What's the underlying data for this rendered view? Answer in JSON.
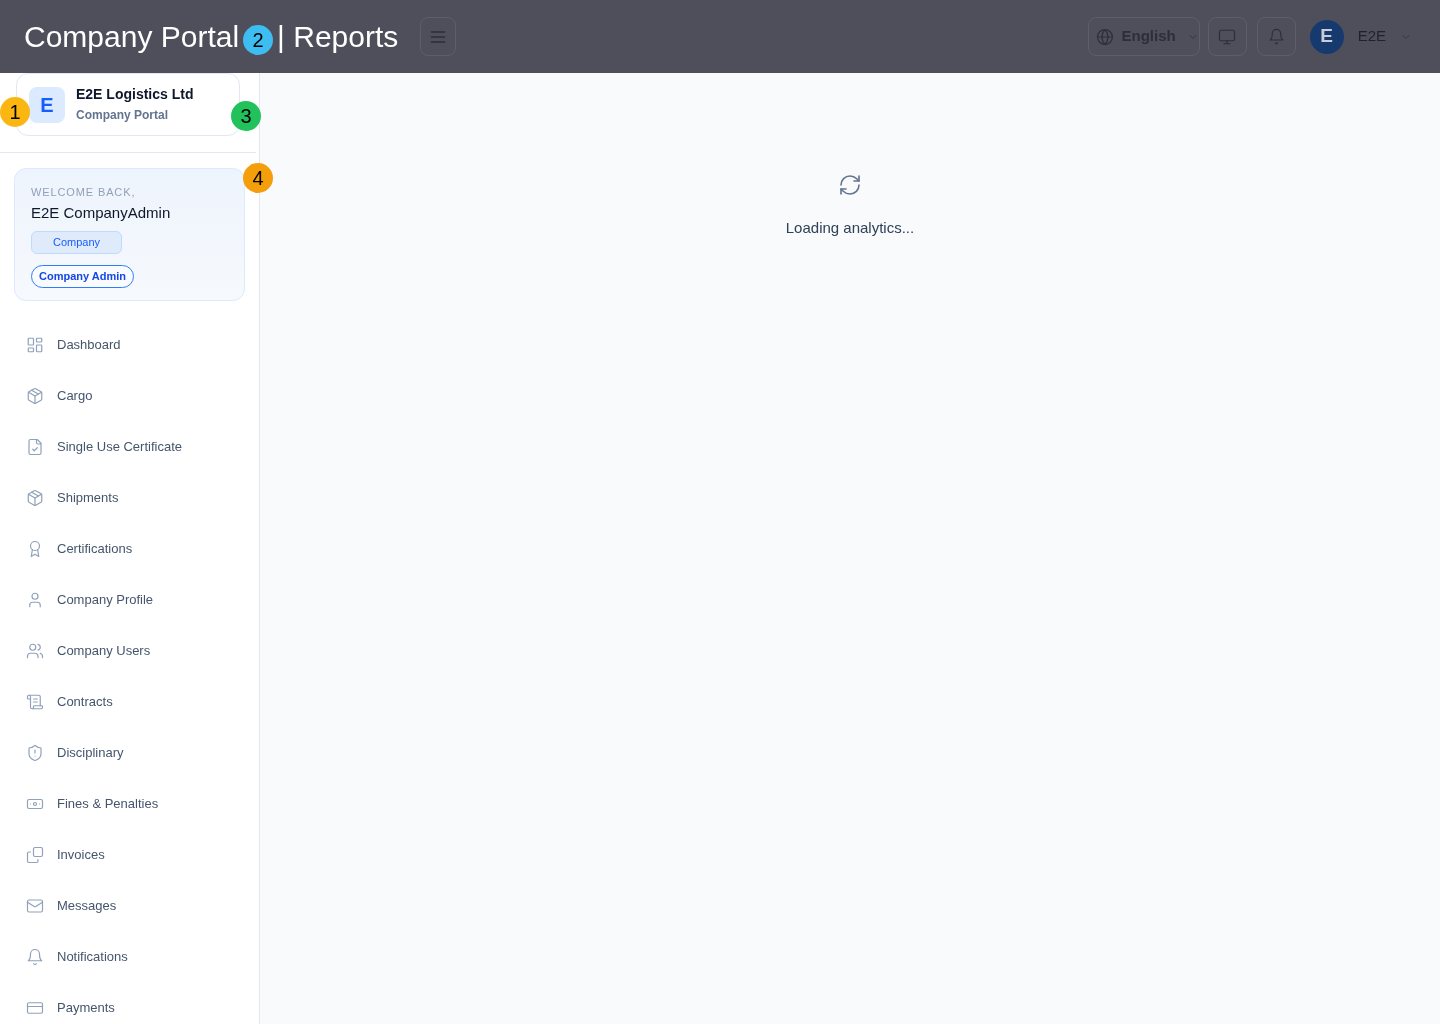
{
  "caption": {
    "section": "Company Portal",
    "separator": "|",
    "page": "Reports"
  },
  "header": {
    "language": "English",
    "user": {
      "initial": "E",
      "name": "E2E"
    }
  },
  "sidebar": {
    "company": {
      "initial": "E",
      "name": "E2E Logistics Ltd",
      "subtitle": "Company Portal"
    },
    "welcome": {
      "greeting": "WELCOME BACK,",
      "name": "E2E CompanyAdmin",
      "badges": [
        {
          "label": "Company",
          "kind": "tag"
        },
        {
          "label": "Company Admin",
          "kind": "pill"
        }
      ]
    },
    "nav_items": [
      {
        "label": "Dashboard",
        "selected": false
      },
      {
        "label": "Cargo",
        "selected": false
      },
      {
        "label": "Single Use Certificate",
        "selected": false
      },
      {
        "label": "Shipments",
        "selected": false
      },
      {
        "label": "Certifications",
        "selected": false
      },
      {
        "label": "Company Profile",
        "selected": false
      },
      {
        "label": "Company Users",
        "selected": false
      },
      {
        "label": "Contracts",
        "selected": false
      },
      {
        "label": "Disciplinary",
        "selected": false
      },
      {
        "label": "Fines & Penalties",
        "selected": false
      },
      {
        "label": "Invoices",
        "selected": false
      },
      {
        "label": "Messages",
        "selected": false
      },
      {
        "label": "Notifications",
        "selected": false
      },
      {
        "label": "Payments",
        "selected": false
      }
    ]
  },
  "main": {
    "loading_text": "Loading analytics..."
  },
  "markers": [
    {
      "label": "1",
      "color": "#fbb612"
    },
    {
      "label": "2",
      "color": "#3ebdf3"
    },
    {
      "label": "3",
      "color": "#21c25c"
    },
    {
      "label": "4",
      "color": "#f59e0b"
    }
  ]
}
